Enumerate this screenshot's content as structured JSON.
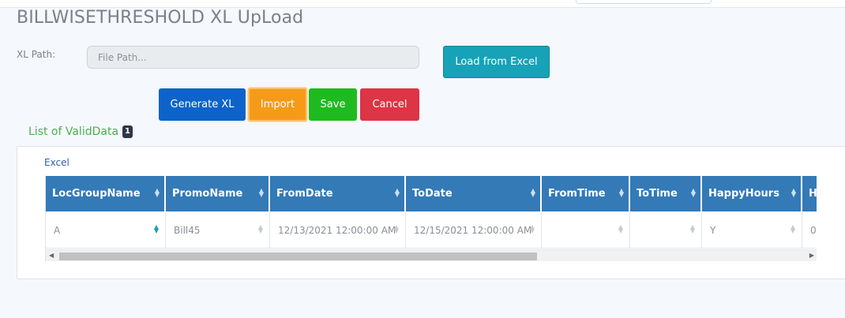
{
  "header": {
    "title": "BILLWISETHRESHOLD XL UpLoad"
  },
  "form": {
    "xl_path_label": "XL Path:",
    "path_placeholder": "File Path...",
    "path_value": "",
    "load_button": "Load from Excel"
  },
  "actions": {
    "generate": "Generate XL",
    "import": "Import",
    "save": "Save",
    "cancel": "Cancel"
  },
  "list": {
    "title": "List of ValidData",
    "badge": "1"
  },
  "tabs": {
    "excel": "Excel"
  },
  "grid": {
    "columns": [
      "LocGroupName",
      "PromoName",
      "FromDate",
      "ToDate",
      "FromTime",
      "ToTime",
      "HappyHours",
      "H"
    ],
    "rows": [
      [
        "A",
        "Bill45",
        "12/13/2021 12:00:00 AM",
        "12/15/2021 12:00:00 AM",
        "",
        "",
        "Y",
        "0"
      ]
    ]
  },
  "colors": {
    "header_bg": "#337ab7",
    "load_btn": "#17a2b8",
    "generate_btn": "#0d63c9",
    "import_btn": "#f59b19",
    "save_btn": "#1fba1f",
    "cancel_btn": "#dc3545",
    "list_title": "#4caf50"
  }
}
